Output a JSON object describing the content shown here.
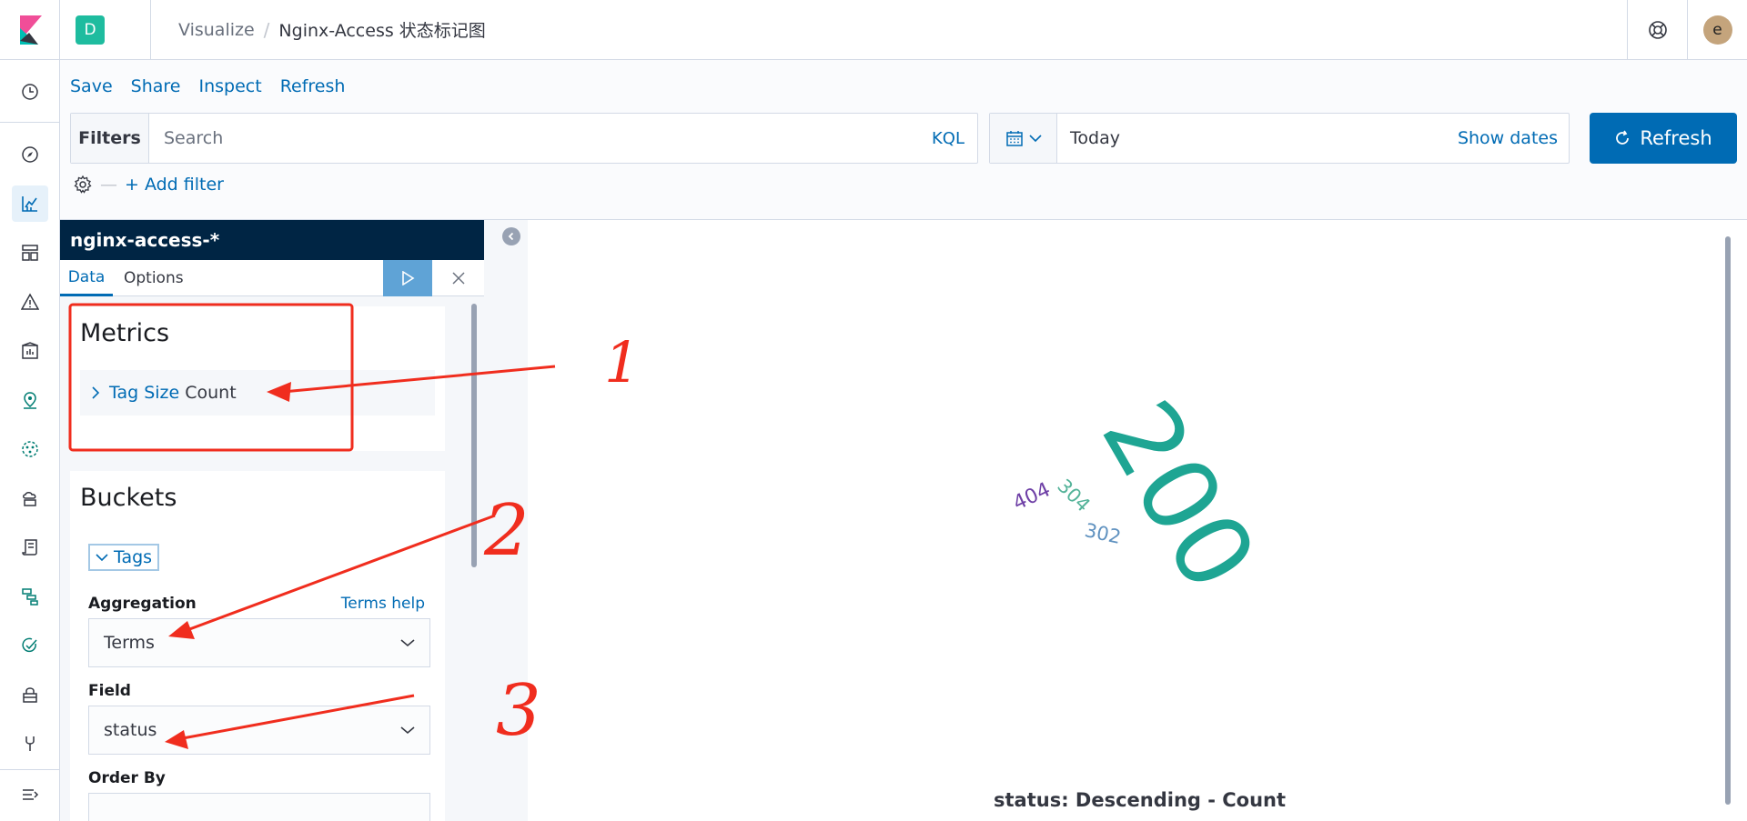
{
  "header": {
    "space_initial": "D",
    "breadcrumb_root": "Visualize",
    "breadcrumb_current": "Nginx-Access 状态标记图",
    "user_initial": "e"
  },
  "menu": {
    "save": "Save",
    "share": "Share",
    "inspect": "Inspect",
    "refresh": "Refresh"
  },
  "query_bar": {
    "filters_label": "Filters",
    "search_placeholder": "Search",
    "language": "KQL",
    "date_value": "Today",
    "show_dates": "Show dates",
    "refresh_button": "Refresh",
    "add_filter": "+ Add filter"
  },
  "editor": {
    "index_pattern": "nginx-access-*",
    "tabs": [
      "Data",
      "Options"
    ],
    "metrics_title": "Metrics",
    "metric_type": "Tag Size",
    "metric_name": "Count",
    "buckets_title": "Buckets",
    "bucket_name": "Tags",
    "aggregation_label": "Aggregation",
    "aggregation_help": "Terms help",
    "aggregation_value": "Terms",
    "field_label": "Field",
    "field_value": "status",
    "order_by_label": "Order By"
  },
  "visualization": {
    "type": "tag-cloud",
    "words": [
      {
        "text": "200",
        "color": "#1ea593"
      },
      {
        "text": "404",
        "color": "#6e3fa6"
      },
      {
        "text": "304",
        "color": "#54b399"
      },
      {
        "text": "302",
        "color": "#6092c0"
      }
    ],
    "legend": "status: Descending - Count"
  },
  "annotations": [
    "1",
    "2",
    "3"
  ],
  "colors": {
    "primary": "#006bb4",
    "header_dark": "#002544",
    "annotation_red": "#f02d1e"
  }
}
